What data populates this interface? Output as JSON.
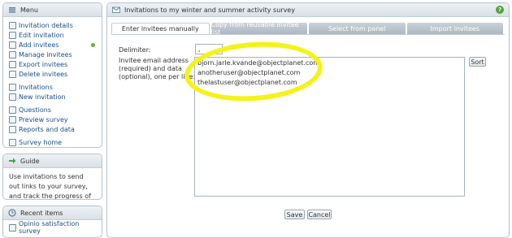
{
  "menu": {
    "title": "Menu",
    "groups": [
      [
        {
          "label": "Invitation details"
        },
        {
          "label": "Edit invitation"
        },
        {
          "label": "Add invitees",
          "active": true
        },
        {
          "label": "Manage invitees"
        },
        {
          "label": "Export invitees"
        },
        {
          "label": "Delete invitees"
        }
      ],
      [
        {
          "label": "Invitations"
        },
        {
          "label": "New invitation"
        }
      ],
      [
        {
          "label": "Questions"
        },
        {
          "label": "Preview survey"
        },
        {
          "label": "Reports and data"
        }
      ],
      [
        {
          "label": "Survey home"
        }
      ]
    ]
  },
  "guide": {
    "title": "Guide",
    "text": "Use invitations to send out links to your survey, and track the progress of your invitees."
  },
  "recent": {
    "title": "Recent items",
    "items": [
      "Opinio satisfaction survey"
    ]
  },
  "main": {
    "title": "Invitations to my winter and summer activity survey",
    "help": "?",
    "tabs": [
      {
        "label": "Enter invitees manually",
        "active": true
      },
      {
        "label": "Copy from reusable invitee list"
      },
      {
        "label": "Select from panel"
      },
      {
        "label": "Import invitees"
      }
    ],
    "delimiter_label": "Delimiter:",
    "delimiter_value": ",",
    "emails_label_1": "Invitee email address",
    "emails_label_2": "(required) and data",
    "emails_label_3": "(optional), one per line:",
    "emails_text": "bjorn.jarle.kvande@objectplanet.com\nanotheruser@objectplanet.com\nthelastuser@objectplanet.com",
    "sort_label": "Sort",
    "save_label": "Save",
    "cancel_label": "Cancel"
  },
  "colors": {
    "highlight": "#f5f21a",
    "link": "#1a4f8a",
    "active_dot": "#5cb82a"
  }
}
